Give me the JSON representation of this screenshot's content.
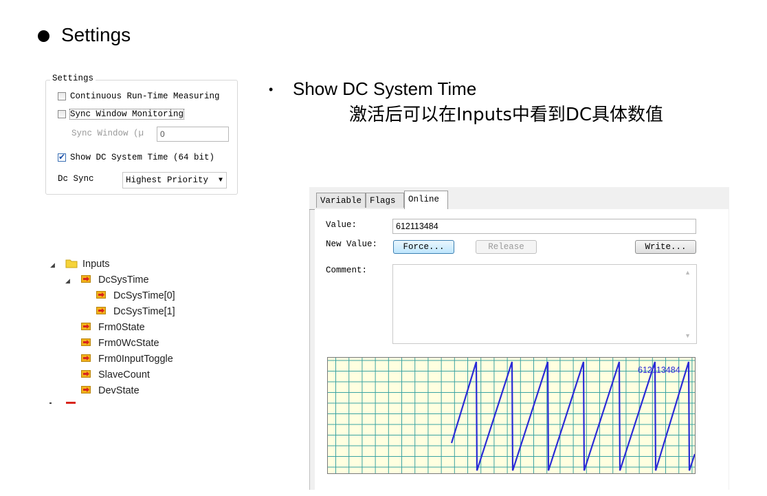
{
  "slide": {
    "heading": "Settings"
  },
  "settings": {
    "legend": "Settings",
    "options": [
      {
        "label": "Continuous Run-Time Measuring",
        "checked": false
      },
      {
        "label": "Sync Window Monitoring",
        "checked": false
      },
      {
        "label": "Show DC System Time (64 bit)",
        "checked": true
      }
    ],
    "sync_window_label": "Sync Window (µ",
    "sync_window_value": "0",
    "dc_sync_label": "Dc Sync",
    "dc_sync_value": "Highest Priority"
  },
  "description": {
    "title": "Show DC System Time",
    "detail": "激活后可以在Inputs中看到DC具体数值"
  },
  "tree": {
    "root": "Inputs",
    "items": [
      {
        "label": "DcSysTime",
        "level": 1,
        "expanded": true
      },
      {
        "label": "DcSysTime[0]",
        "level": 2
      },
      {
        "label": "DcSysTime[1]",
        "level": 2
      },
      {
        "label": "Frm0State",
        "level": 1
      },
      {
        "label": "Frm0WcState",
        "level": 1
      },
      {
        "label": "Frm0InputToggle",
        "level": 1
      },
      {
        "label": "SlaveCount",
        "level": 1
      },
      {
        "label": "DevState",
        "level": 1
      }
    ]
  },
  "online_panel": {
    "tabs": [
      "Variable",
      "Flags",
      "Online"
    ],
    "active_tab": "Online",
    "value_label": "Value:",
    "value": "612113484",
    "new_value_label": "New Value:",
    "force_label": "Force...",
    "release_label": "Release",
    "write_label": "Write...",
    "comment_label": "Comment:",
    "trend_value_label": "612113484",
    "trend_line_color": "#2b2bd6",
    "trend_grid_color": "#3aa3a3",
    "trend_background": "#ffffe0"
  }
}
